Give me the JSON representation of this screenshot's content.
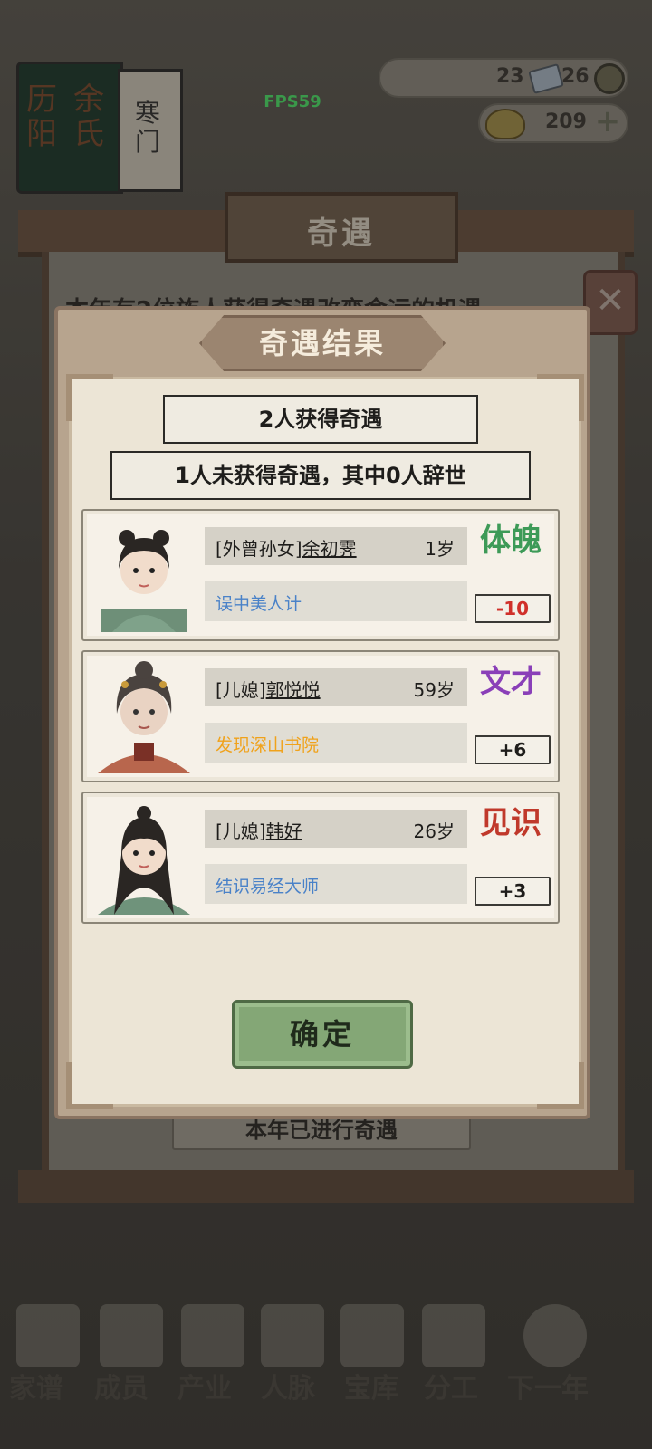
{
  "hud": {
    "fps": "FPS59",
    "book": {
      "volume_text": "历阳",
      "family_text": "余氏",
      "tag_text": "寒门"
    },
    "resource1": "23",
    "resource2": "26",
    "gold": "209"
  },
  "parent_dialog": {
    "title": "奇遇",
    "description": "本年有2位族人获得奇遇改变命运的机遇",
    "status": "本年已进行奇遇"
  },
  "result_dialog": {
    "title": "奇遇结果",
    "gained": "2人获得奇遇",
    "not_gained": "1人未获得奇遇，其中0人辞世",
    "confirm_label": "确定",
    "cards": [
      {
        "relation": "[外曾孙女]",
        "name": "余初霁",
        "age": "1岁",
        "event": "误中美人计",
        "attribute": "体魄",
        "delta": "-10"
      },
      {
        "relation": "[儿媳]",
        "name": "郭悦悦",
        "age": "59岁",
        "event": "发现深山书院",
        "attribute": "文才",
        "delta": "+6"
      },
      {
        "relation": "[儿媳]",
        "name": "韩好",
        "age": "26岁",
        "event": "结识易经大师",
        "attribute": "见识",
        "delta": "+3"
      }
    ]
  },
  "bottom_nav": [
    "家谱",
    "成员",
    "产业",
    "人脉",
    "宝库",
    "分工",
    "下一年"
  ],
  "colors": {
    "event_blue": "#4a82c8",
    "event_orange": "#f0a21b",
    "attr_green": "#3d9a57",
    "attr_purple": "#8a3fb8",
    "attr_red": "#c0392b",
    "negative": "#d0302a",
    "confirm_green": "#84a776"
  }
}
